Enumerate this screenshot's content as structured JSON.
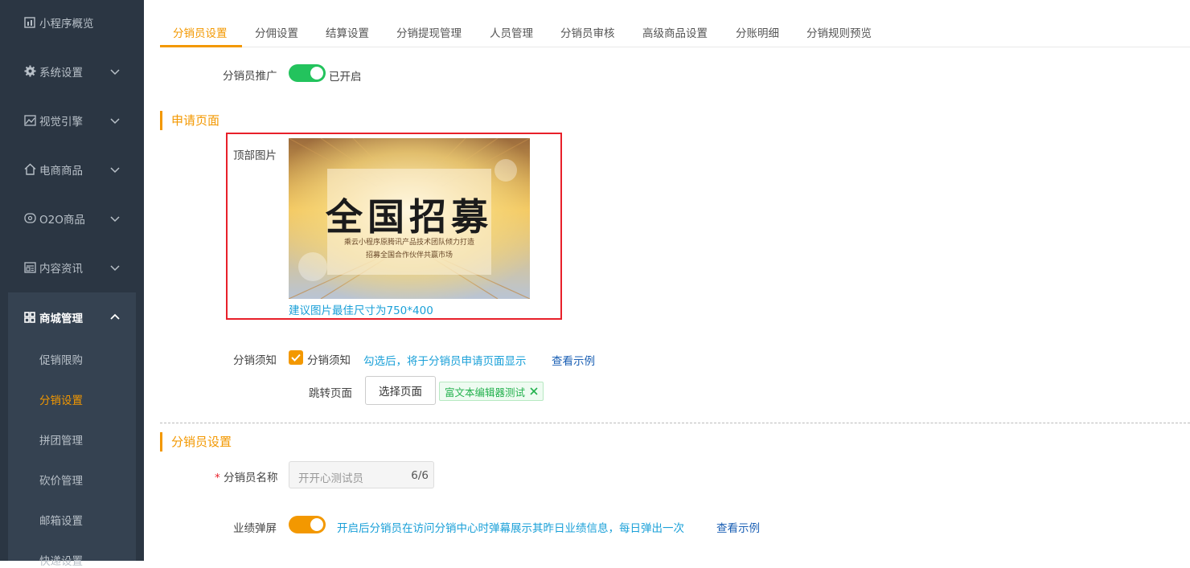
{
  "sidebar": {
    "items": [
      {
        "label": "小程序概览",
        "icon": "dashboard-icon"
      },
      {
        "label": "系统设置",
        "icon": "gear-icon"
      },
      {
        "label": "视觉引擎",
        "icon": "image-icon"
      },
      {
        "label": "电商商品",
        "icon": "home-icon"
      },
      {
        "label": "O2O商品",
        "icon": "o2o-icon"
      },
      {
        "label": "内容资讯",
        "icon": "news-icon"
      },
      {
        "label": "商城管理",
        "icon": "grid-icon"
      }
    ],
    "sub_items": [
      "促销限购",
      "分销设置",
      "拼团管理",
      "砍价管理",
      "邮箱设置",
      "快递设置"
    ]
  },
  "tabs": [
    "分销员设置",
    "分佣设置",
    "结算设置",
    "分销提现管理",
    "人员管理",
    "分销员审核",
    "高级商品设置",
    "分账明细",
    "分销规则预览"
  ],
  "promo": {
    "label": "分销员推广",
    "status": "已开启"
  },
  "apply_section": {
    "title": "申请页面"
  },
  "top_image": {
    "label": "顶部图片",
    "banner_title": "全国招募",
    "banner_line1": "乘云小程序原腾讯产品技术团队倾力打造",
    "banner_line2": "招募全国合作伙伴共赢市场",
    "hint": "建议图片最佳尺寸为750*400"
  },
  "notice": {
    "label": "分销须知",
    "checkbox_label": "分销须知",
    "hint": "勾选后，将于分销员申请页面显示",
    "link": "查看示例"
  },
  "jump": {
    "label": "跳转页面",
    "button": "选择页面",
    "tag": "富文本编辑器测试"
  },
  "distributor_section": {
    "title": "分销员设置"
  },
  "name_field": {
    "required_mark": "*",
    "label": "分销员名称",
    "placeholder": "开开心测试员",
    "counter": "6/6"
  },
  "popup": {
    "label": "业绩弹屏",
    "hint": "开启后分销员在访问分销中心时弹幕展示其昨日业绩信息，每日弹出一次",
    "link": "查看示例"
  },
  "colors": {
    "accent": "#f39800",
    "switch_on": "#23c35d",
    "link_blue": "#1aa0d8",
    "sidebar_bg": "#2b3643"
  }
}
